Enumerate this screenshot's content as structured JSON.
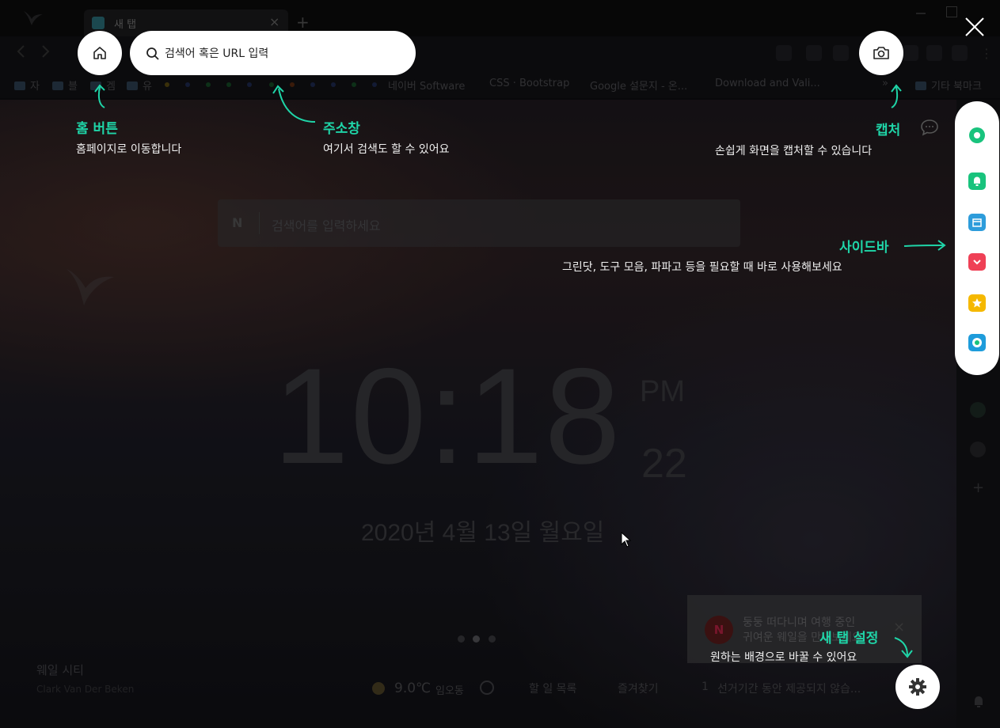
{
  "browser": {
    "tab_title": "새 탭",
    "tab_close": "×",
    "new_tab": "+",
    "bookmarks": [
      {
        "label": "자",
        "type": "folder"
      },
      {
        "label": "블",
        "type": "folder"
      },
      {
        "label": "겜",
        "type": "folder"
      },
      {
        "label": "유",
        "type": "folder"
      },
      {
        "label": "네이버 Software",
        "type": "link"
      },
      {
        "label": "CSS · Bootstrap",
        "type": "link"
      },
      {
        "label": "Google 설문지 - 온...",
        "type": "link"
      },
      {
        "label": "Download and Vali...",
        "type": "link"
      },
      {
        "label": "»",
        "type": "more"
      },
      {
        "label": "기타 북마크",
        "type": "folder"
      }
    ]
  },
  "overlay": {
    "url_placeholder": "검색어 혹은 URL 입력",
    "close_label": "×",
    "callouts": {
      "home": {
        "title": "홈 버튼",
        "desc": "홈페이지로 이동합니다"
      },
      "address": {
        "title": "주소창",
        "desc": "여기서 검색도 할 수 있어요"
      },
      "capture": {
        "title": "캡처",
        "desc": "손쉽게 화면을 캡처할 수 있습니다"
      },
      "sidebar": {
        "title": "사이드바",
        "desc": "그린닷, 도구 모음, 파파고 등을 필요할 때 바로 사용해보세요"
      },
      "newtab": {
        "title": "새 탭 설정",
        "desc": "원하는 배경으로 바꿀 수 있어요"
      }
    }
  },
  "sidebar": {
    "icons": [
      "greendot-icon",
      "alarm-icon",
      "calendar-icon",
      "pocket-icon",
      "favorite-icon",
      "papago-icon"
    ],
    "colors": [
      "#19c37d",
      "#19c37d",
      "#2d9cdb",
      "#ef4056",
      "#f5b800",
      "#1e9cdb"
    ]
  },
  "newtab": {
    "search_logo": "N",
    "search_placeholder": "검색어를 입력하세요",
    "clock": {
      "time": "10:18",
      "ampm": "PM",
      "seconds": "22"
    },
    "date": "2020년 4월 13일 월요일",
    "city": {
      "title": "웨일 시티",
      "credit": "Clark Van Der Beken"
    },
    "weather": {
      "temp": "9.0℃",
      "location": "임오동"
    },
    "widgets": {
      "todo": "할 일 목록",
      "favorites": "즐겨찾기"
    },
    "news": {
      "rank": "1",
      "text": "선거기간 동안 제공되지 않습..."
    },
    "notice": {
      "logo": "N",
      "line1": "둥둥 떠다니며 여행 중인",
      "line2": "귀여운 웨일을 만나보세요",
      "close": "×"
    }
  }
}
